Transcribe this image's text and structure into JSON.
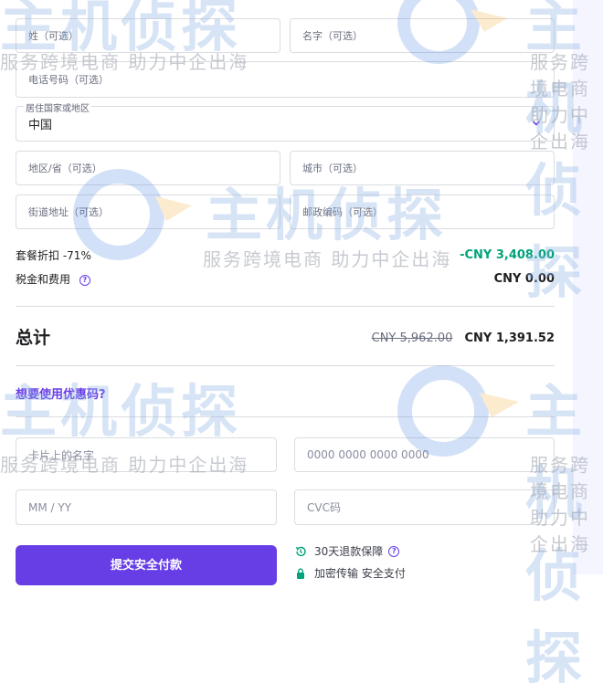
{
  "form": {
    "last_name_placeholder": "姓（可选）",
    "first_name_placeholder": "名字（可选）",
    "phone_placeholder": "电话号码（可选）",
    "country_label": "居住国家或地区",
    "country_value": "中国",
    "region_placeholder": "地区/省（可选）",
    "city_placeholder": "城市（可选）",
    "street_placeholder": "街道地址（可选）",
    "postal_placeholder": "邮政编码（可选）"
  },
  "summary": {
    "discount_label": "套餐折扣",
    "discount_pct": "-71%",
    "discount_value": "-CNY 3,408.00",
    "tax_label": "税金和费用",
    "tax_value": "CNY 0.00",
    "total_label": "总计",
    "original_price": "CNY 5,962.00",
    "total_value": "CNY 1,391.52"
  },
  "coupon_link": "想要使用优惠码?",
  "card": {
    "name_placeholder": "卡片上的名字",
    "number_placeholder": "0000 0000 0000 0000",
    "expiry_placeholder": "MM / YY",
    "cvc_placeholder": "CVC码"
  },
  "pay_button": "提交安全付款",
  "guarantees": {
    "refund": "30天退款保障",
    "secure": "加密传输 安全支付"
  },
  "watermark": {
    "brand": "主机侦探",
    "slogan": "服务跨境电商 助力中企出海"
  },
  "colors": {
    "accent": "#673de6",
    "green": "#00a37a"
  }
}
